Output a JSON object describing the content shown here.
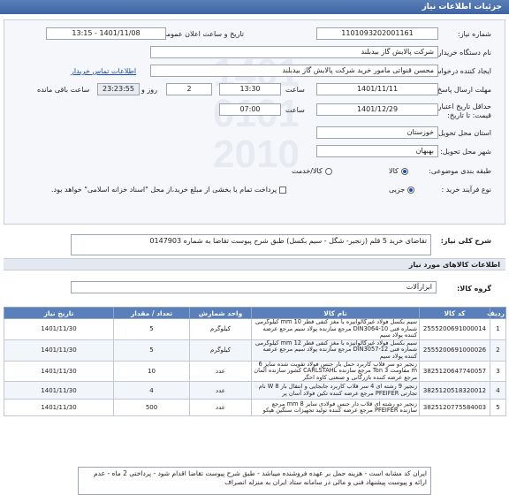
{
  "header": {
    "title": "جزئیات اطلاعات نیاز"
  },
  "form": {
    "need_number_label": "شماره نیاز:",
    "need_number": "1101093202001161",
    "announce_label": "تاریخ و ساعت اعلان عمومی:",
    "announce_value": "1401/11/08 - 13:15",
    "buyer_label": "نام دستگاه خریدار:",
    "buyer_value": "شرکت پالایش گاز بیدبلند",
    "creator_label": "ایجاد کننده درخواست:",
    "creator_value": "محسن قنواتی مامور خرید شرکت پالایش گاز بیدبلند",
    "contact_link": "اطلاعات تماس خریدار",
    "deadline_label": "مهلت ارسال پاسخ: تا",
    "deadline_date": "1401/11/11",
    "time_label": "ساعت",
    "deadline_time": "13:30",
    "days_value": "2",
    "days_label": "روز و",
    "remaining_time": "23:23:55",
    "remaining_label": "ساعت باقی مانده",
    "validity_label": "حداقل تاریخ اعتبار قیمت: تا تاریخ:",
    "validity_date": "1401/12/29",
    "validity_time_label": "ساعت",
    "validity_time": "07:00",
    "province_label": "استان محل تحویل:",
    "province_value": "خوزستان",
    "city_label": "شهر محل تحویل:",
    "city_value": "بهبهان",
    "category_label": "طبقه بندی موضوعی:",
    "category_options": [
      "کالا",
      "کالا/خدمت"
    ],
    "purchase_label": "نوع فرآیند خرید :",
    "purchase_option": "جزیی",
    "payment_text": "پرداخت تمام یا بخشی از مبلغ خرید،از محل \"اسناد خزانه اسلامی\" خواهد بود."
  },
  "description": {
    "label": "شرح کلی نیاز:",
    "text": "تقاضای خرید 5 قلم (زنجیر- شگل - سیم بکسل) طبق شرح پیوست تقاضا به شماره 0147903"
  },
  "goods": {
    "section_title": "اطلاعات کالاهای مورد نیاز",
    "group_label": "گروه کالا:",
    "group_value": "ابزارآلات",
    "columns": [
      "ردیف",
      "کد کالا",
      "نام کالا",
      "واحد شمارش",
      "تعداد / مقدار",
      "تاریخ نیاز"
    ],
    "rows": [
      [
        "1",
        "2555200691000014",
        "سیم بکسل فولاد غیرگالوانیزه با مغز کنفی قطر 10 mm کیلوگرمی شماره فنی DIN3064-10 مرجع سازنده پولاد سیم مرجع عرضه کننده پولاد سیم",
        "کیلوگرم",
        "5",
        "1401/11/30"
      ],
      [
        "2",
        "2555200691000026",
        "سیم بکسل فولاد غیرگالوانیزه با مغز کنفی قطر 12 mm کیلوگرمی شماره فنی DIN3057-12 مرجع سازنده پولاد سیم مرجع عرضه کننده پولاد سیم",
        "کیلوگرم",
        "5",
        "1401/11/30"
      ],
      [
        "3",
        "3825120647740057",
        "زنجیر دو سر قلاب کاربرد حمل بار جنس فولاد تقویت شده سایز 6 m مقاومت Ton 3 مرجع سازنده CARLSTAHL کشور سازنده آلمان مرجع عرضه کننده بازرگانی و صنعتی کاوه اخگر",
        "عدد",
        "10",
        "1401/11/30"
      ],
      [
        "4",
        "3825120518320012",
        "زنجیر 9 رشته ای 4 سر قلاب کاربرد جابجایی و انتقال بار W 8 نام تجارتی PFEIFER مرجع عرضه کننده تکین فولاد آسان پر",
        "عدد",
        "4",
        "1401/11/30"
      ],
      [
        "5",
        "3825120775584003",
        "زنجیر دو رشته ای قلاب دار جنس فولادی سایز 8 mm مرجع سازنده PFEIFER مرجع عرضه کننده تولید تجهیزات سنگین هپکو",
        "عدد",
        "500",
        "1401/11/30"
      ]
    ]
  },
  "buyer_notes": "ایران کد مشابه است - هزینه حمل بر عهده فروشنده میباشد - طبق شرح پیوست تقاضا اقدام شود - پرداختی 2 ماه - عدم ارائه و پیوست پیشنهاد فنی و مالی در سامانه ستاد ایران به منزله انصراف"
}
